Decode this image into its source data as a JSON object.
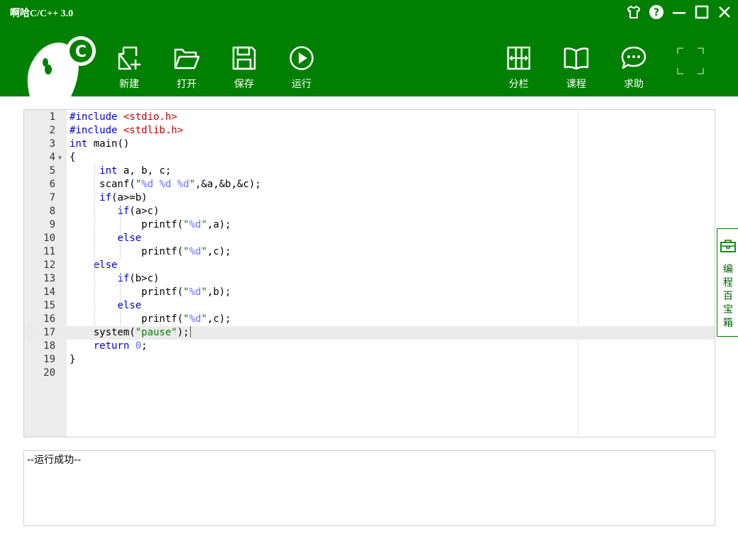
{
  "window": {
    "title": "啊哈C/C++ 3.0"
  },
  "toolbar": {
    "new_label": "新建",
    "open_label": "打开",
    "save_label": "保存",
    "run_label": "运行",
    "split_label": "分栏",
    "course_label": "课程",
    "help_label": "求助"
  },
  "logo": {
    "letter": "C"
  },
  "editor": {
    "active_line": 17,
    "folded_line": 4,
    "lines": [
      {
        "n": "1",
        "code": [
          {
            "t": "#include ",
            "c": "k"
          },
          {
            "t": "<stdio.h>",
            "c": "i"
          }
        ]
      },
      {
        "n": "2",
        "code": [
          {
            "t": "#include ",
            "c": "k"
          },
          {
            "t": "<stdlib.h>",
            "c": "i"
          }
        ]
      },
      {
        "n": "3",
        "code": [
          {
            "t": "int",
            "c": "k"
          },
          {
            "t": " main()",
            "c": ""
          }
        ]
      },
      {
        "n": "4",
        "code": [
          {
            "t": "{",
            "c": ""
          }
        ]
      },
      {
        "n": "5",
        "code": [
          {
            "t": "     ",
            "c": ""
          },
          {
            "t": "int",
            "c": "k"
          },
          {
            "t": " a, b, c;",
            "c": ""
          }
        ]
      },
      {
        "n": "6",
        "code": [
          {
            "t": "     scanf(",
            "c": ""
          },
          {
            "t": "\"",
            "c": "s"
          },
          {
            "t": "%d %d %d",
            "c": "f"
          },
          {
            "t": "\"",
            "c": "s"
          },
          {
            "t": ",&a,&b,&c);",
            "c": ""
          }
        ]
      },
      {
        "n": "7",
        "code": [
          {
            "t": "     ",
            "c": ""
          },
          {
            "t": "if",
            "c": "k"
          },
          {
            "t": "(a>=b)",
            "c": ""
          }
        ]
      },
      {
        "n": "8",
        "code": [
          {
            "t": "        ",
            "c": ""
          },
          {
            "t": "if",
            "c": "k"
          },
          {
            "t": "(a>c)",
            "c": ""
          }
        ]
      },
      {
        "n": "9",
        "code": [
          {
            "t": "            printf(",
            "c": ""
          },
          {
            "t": "\"",
            "c": "s"
          },
          {
            "t": "%d",
            "c": "f"
          },
          {
            "t": "\"",
            "c": "s"
          },
          {
            "t": ",a);",
            "c": ""
          }
        ]
      },
      {
        "n": "10",
        "code": [
          {
            "t": "        ",
            "c": ""
          },
          {
            "t": "else",
            "c": "k"
          }
        ]
      },
      {
        "n": "11",
        "code": [
          {
            "t": "            printf(",
            "c": ""
          },
          {
            "t": "\"",
            "c": "s"
          },
          {
            "t": "%d",
            "c": "f"
          },
          {
            "t": "\"",
            "c": "s"
          },
          {
            "t": ",c);",
            "c": ""
          }
        ]
      },
      {
        "n": "12",
        "code": [
          {
            "t": "    ",
            "c": ""
          },
          {
            "t": "else",
            "c": "k"
          }
        ]
      },
      {
        "n": "13",
        "code": [
          {
            "t": "        ",
            "c": ""
          },
          {
            "t": "if",
            "c": "k"
          },
          {
            "t": "(b>c)",
            "c": ""
          }
        ]
      },
      {
        "n": "14",
        "code": [
          {
            "t": "            printf(",
            "c": ""
          },
          {
            "t": "\"",
            "c": "s"
          },
          {
            "t": "%d",
            "c": "f"
          },
          {
            "t": "\"",
            "c": "s"
          },
          {
            "t": ",b);",
            "c": ""
          }
        ]
      },
      {
        "n": "15",
        "code": [
          {
            "t": "        ",
            "c": ""
          },
          {
            "t": "else",
            "c": "k"
          }
        ]
      },
      {
        "n": "16",
        "code": [
          {
            "t": "            printf(",
            "c": ""
          },
          {
            "t": "\"",
            "c": "s"
          },
          {
            "t": "%d",
            "c": "f"
          },
          {
            "t": "\"",
            "c": "s"
          },
          {
            "t": ",c);",
            "c": ""
          }
        ]
      },
      {
        "n": "17",
        "code": [
          {
            "t": "    system(",
            "c": ""
          },
          {
            "t": "\"pause\"",
            "c": "s"
          },
          {
            "t": ");",
            "c": ""
          }
        ]
      },
      {
        "n": "18",
        "code": [
          {
            "t": "    ",
            "c": ""
          },
          {
            "t": "return",
            "c": "k"
          },
          {
            "t": " ",
            "c": ""
          },
          {
            "t": "0",
            "c": "f"
          },
          {
            "t": ";",
            "c": ""
          }
        ]
      },
      {
        "n": "19",
        "code": [
          {
            "t": "}",
            "c": ""
          }
        ]
      },
      {
        "n": "20",
        "code": []
      }
    ]
  },
  "output": {
    "text": "--运行成功--"
  },
  "sidetab": {
    "chars": [
      "编",
      "程",
      "百",
      "宝",
      "箱"
    ]
  },
  "colors": {
    "brand": "#008000",
    "keyword": "#0000d0",
    "string": "#008000",
    "format": "#6e6eff",
    "include": "#c00000"
  },
  "icons": [
    "tshirt-icon",
    "help-icon",
    "minimize-icon",
    "maximize-icon",
    "close-icon",
    "new-file-icon",
    "open-folder-icon",
    "save-icon",
    "run-icon",
    "split-icon",
    "book-icon",
    "chat-icon",
    "toolbox-icon"
  ]
}
